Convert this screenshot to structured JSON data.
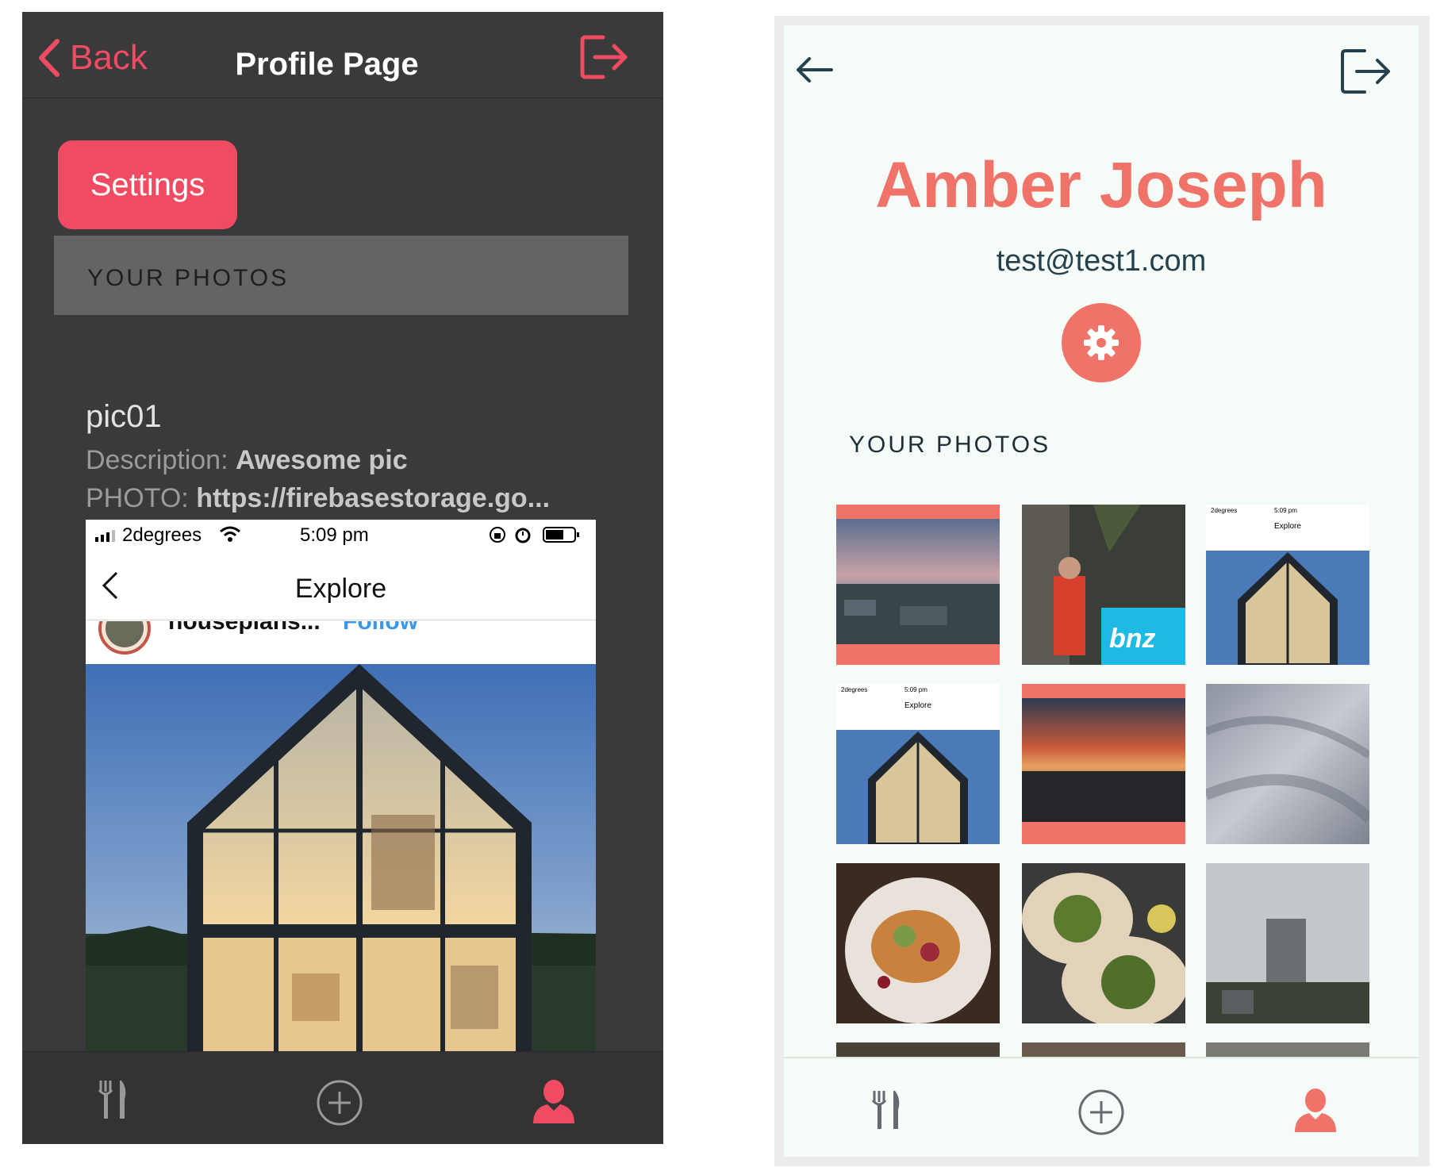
{
  "colors": {
    "left_accent": "#ef4b63",
    "left_bg": "#3a3a3a",
    "right_accent": "#f0736a",
    "right_bg": "#f5fbf7",
    "right_text_dark": "#24414d"
  },
  "left": {
    "nav": {
      "back_label": "Back",
      "title": "Profile Page",
      "logout_icon": "logout-icon"
    },
    "settings_label": "Settings",
    "section_title": "YOUR PHOTOS",
    "photo": {
      "title": "pic01",
      "description_label": "Description:",
      "description_value": "Awesome pic",
      "photo_label": "PHOTO:",
      "photo_value": "https://firebasestorage.go..."
    },
    "embedded_screenshot": {
      "carrier": "2degrees",
      "time": "5:09 pm",
      "title": "Explore",
      "cut_user": "houseplans...",
      "cut_follow": "Follow"
    },
    "tabbar": [
      "fork-knife-icon",
      "add-circle-icon",
      "profile-icon"
    ]
  },
  "right": {
    "name": "Amber Joseph",
    "email": "test@test1.com",
    "settings_icon": "gear-icon",
    "section_title": "YOUR PHOTOS",
    "photos": [
      "sunset-city",
      "person-bnz-sign",
      "house-screenshot",
      "house-screenshot",
      "sunset-harbour",
      "fabric-texture",
      "food-plate",
      "tacos",
      "apartment-tower"
    ],
    "mini_screenshot": {
      "carrier": "2degrees",
      "time": "5:09 pm",
      "title": "Explore"
    },
    "bnz_sign": "bnz",
    "tabbar": [
      "fork-knife-icon",
      "add-circle-icon",
      "profile-icon"
    ]
  }
}
